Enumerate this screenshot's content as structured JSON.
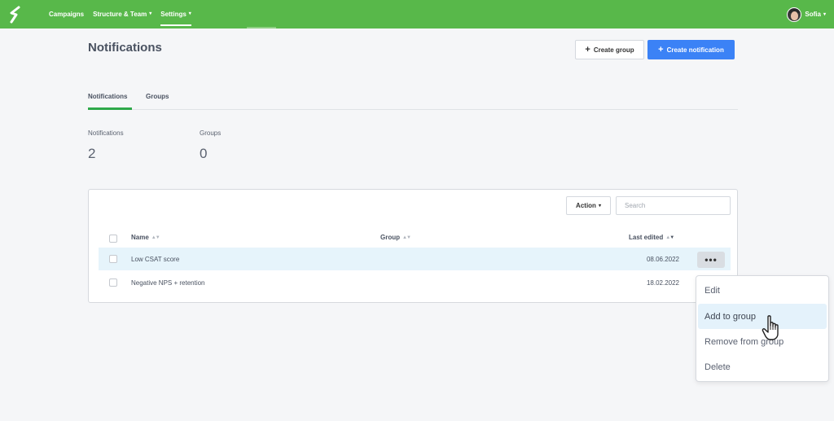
{
  "topbar": {
    "nav": [
      {
        "label": "Campaigns",
        "has_caret": false
      },
      {
        "label": "Structure & Team",
        "has_caret": true
      },
      {
        "label": "Settings",
        "has_caret": true
      }
    ],
    "user_name": "Sofia",
    "bg_color": "#58b84a"
  },
  "page": {
    "title": "Notifications",
    "create_group_label": "Create group",
    "create_notification_label": "Create notification"
  },
  "tabs": [
    {
      "label": "Notifications",
      "active": true
    },
    {
      "label": "Groups",
      "active": false
    }
  ],
  "stats": {
    "notifications_label": "Notifications",
    "notifications_value": "2",
    "groups_label": "Groups",
    "groups_value": "0"
  },
  "table": {
    "action_label": "Action",
    "search_placeholder": "Search",
    "columns": {
      "name": "Name",
      "group": "Group",
      "last_edited": "Last edited"
    },
    "rows": [
      {
        "name": "Low CSAT score",
        "group": "",
        "last_edited": "08.06.2022",
        "highlighted": true
      },
      {
        "name": "Negative NPS + retention",
        "group": "",
        "last_edited": "18.02.2022",
        "highlighted": false
      }
    ],
    "more_label": "•••"
  },
  "dropdown": {
    "items": [
      "Edit",
      "Add to group",
      "Remove from group",
      "Delete"
    ],
    "hovered": "Add to group"
  },
  "colors": {
    "accent_green": "#2ea84a",
    "primary_blue": "#3b82f6"
  }
}
